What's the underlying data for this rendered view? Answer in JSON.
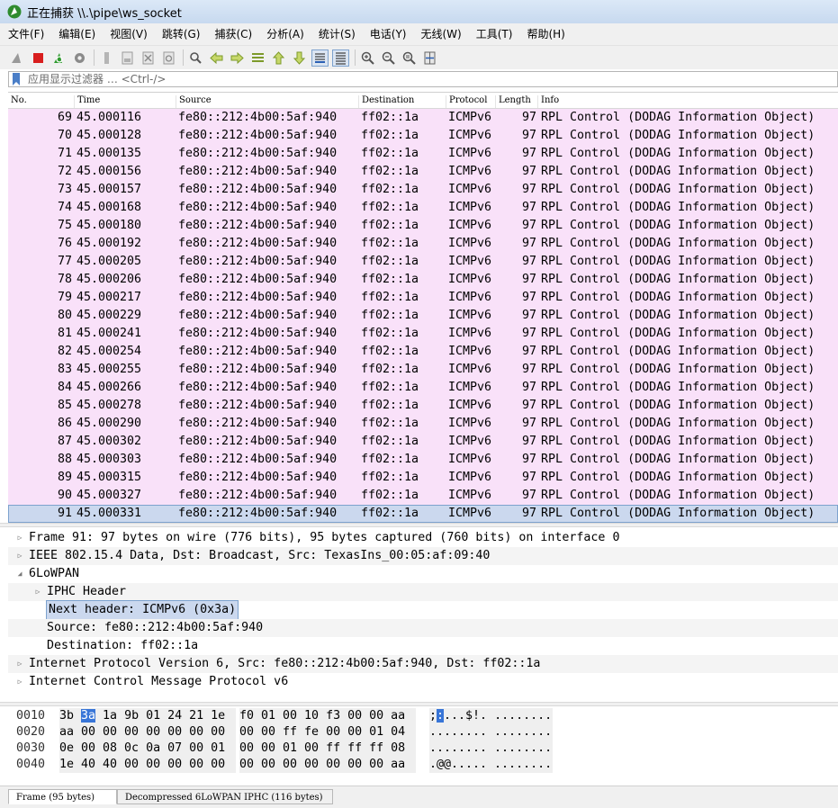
{
  "window": {
    "title": "正在捕获 \\\\.\\pipe\\ws_socket"
  },
  "menu": [
    "文件(F)",
    "编辑(E)",
    "视图(V)",
    "跳转(G)",
    "捕获(C)",
    "分析(A)",
    "统计(S)",
    "电话(Y)",
    "无线(W)",
    "工具(T)",
    "帮助(H)"
  ],
  "toolbar_icons": [
    "shark-fin-start-icon",
    "stop-capture-icon",
    "restart-capture-icon",
    "capture-options-icon",
    "open-file-icon",
    "save-file-icon",
    "close-file-icon",
    "reload-icon",
    "find-packet-icon",
    "go-back-icon",
    "go-forward-icon",
    "go-to-packet-icon",
    "go-first-icon",
    "go-last-icon",
    "auto-scroll-icon",
    "colorize-icon",
    "zoom-in-icon",
    "zoom-out-icon",
    "normal-size-icon",
    "resize-columns-icon"
  ],
  "filter": {
    "placeholder": "应用显示过滤器 … <Ctrl-/>"
  },
  "packet_list": {
    "columns": [
      "No.",
      "Time",
      "Source",
      "Destination",
      "Protocol",
      "Length",
      "Info"
    ],
    "row_color": "#f9e1f9",
    "selected_color": "#cbd8ee",
    "rows": [
      {
        "no": "69",
        "time": "45.000116",
        "src": "fe80::212:4b00:5af:940",
        "dst": "ff02::1a",
        "proto": "ICMPv6",
        "len": "97",
        "info": "RPL Control (DODAG Information Object)"
      },
      {
        "no": "70",
        "time": "45.000128",
        "src": "fe80::212:4b00:5af:940",
        "dst": "ff02::1a",
        "proto": "ICMPv6",
        "len": "97",
        "info": "RPL Control (DODAG Information Object)"
      },
      {
        "no": "71",
        "time": "45.000135",
        "src": "fe80::212:4b00:5af:940",
        "dst": "ff02::1a",
        "proto": "ICMPv6",
        "len": "97",
        "info": "RPL Control (DODAG Information Object)"
      },
      {
        "no": "72",
        "time": "45.000156",
        "src": "fe80::212:4b00:5af:940",
        "dst": "ff02::1a",
        "proto": "ICMPv6",
        "len": "97",
        "info": "RPL Control (DODAG Information Object)"
      },
      {
        "no": "73",
        "time": "45.000157",
        "src": "fe80::212:4b00:5af:940",
        "dst": "ff02::1a",
        "proto": "ICMPv6",
        "len": "97",
        "info": "RPL Control (DODAG Information Object)"
      },
      {
        "no": "74",
        "time": "45.000168",
        "src": "fe80::212:4b00:5af:940",
        "dst": "ff02::1a",
        "proto": "ICMPv6",
        "len": "97",
        "info": "RPL Control (DODAG Information Object)"
      },
      {
        "no": "75",
        "time": "45.000180",
        "src": "fe80::212:4b00:5af:940",
        "dst": "ff02::1a",
        "proto": "ICMPv6",
        "len": "97",
        "info": "RPL Control (DODAG Information Object)"
      },
      {
        "no": "76",
        "time": "45.000192",
        "src": "fe80::212:4b00:5af:940",
        "dst": "ff02::1a",
        "proto": "ICMPv6",
        "len": "97",
        "info": "RPL Control (DODAG Information Object)"
      },
      {
        "no": "77",
        "time": "45.000205",
        "src": "fe80::212:4b00:5af:940",
        "dst": "ff02::1a",
        "proto": "ICMPv6",
        "len": "97",
        "info": "RPL Control (DODAG Information Object)"
      },
      {
        "no": "78",
        "time": "45.000206",
        "src": "fe80::212:4b00:5af:940",
        "dst": "ff02::1a",
        "proto": "ICMPv6",
        "len": "97",
        "info": "RPL Control (DODAG Information Object)"
      },
      {
        "no": "79",
        "time": "45.000217",
        "src": "fe80::212:4b00:5af:940",
        "dst": "ff02::1a",
        "proto": "ICMPv6",
        "len": "97",
        "info": "RPL Control (DODAG Information Object)"
      },
      {
        "no": "80",
        "time": "45.000229",
        "src": "fe80::212:4b00:5af:940",
        "dst": "ff02::1a",
        "proto": "ICMPv6",
        "len": "97",
        "info": "RPL Control (DODAG Information Object)"
      },
      {
        "no": "81",
        "time": "45.000241",
        "src": "fe80::212:4b00:5af:940",
        "dst": "ff02::1a",
        "proto": "ICMPv6",
        "len": "97",
        "info": "RPL Control (DODAG Information Object)"
      },
      {
        "no": "82",
        "time": "45.000254",
        "src": "fe80::212:4b00:5af:940",
        "dst": "ff02::1a",
        "proto": "ICMPv6",
        "len": "97",
        "info": "RPL Control (DODAG Information Object)"
      },
      {
        "no": "83",
        "time": "45.000255",
        "src": "fe80::212:4b00:5af:940",
        "dst": "ff02::1a",
        "proto": "ICMPv6",
        "len": "97",
        "info": "RPL Control (DODAG Information Object)"
      },
      {
        "no": "84",
        "time": "45.000266",
        "src": "fe80::212:4b00:5af:940",
        "dst": "ff02::1a",
        "proto": "ICMPv6",
        "len": "97",
        "info": "RPL Control (DODAG Information Object)"
      },
      {
        "no": "85",
        "time": "45.000278",
        "src": "fe80::212:4b00:5af:940",
        "dst": "ff02::1a",
        "proto": "ICMPv6",
        "len": "97",
        "info": "RPL Control (DODAG Information Object)"
      },
      {
        "no": "86",
        "time": "45.000290",
        "src": "fe80::212:4b00:5af:940",
        "dst": "ff02::1a",
        "proto": "ICMPv6",
        "len": "97",
        "info": "RPL Control (DODAG Information Object)"
      },
      {
        "no": "87",
        "time": "45.000302",
        "src": "fe80::212:4b00:5af:940",
        "dst": "ff02::1a",
        "proto": "ICMPv6",
        "len": "97",
        "info": "RPL Control (DODAG Information Object)"
      },
      {
        "no": "88",
        "time": "45.000303",
        "src": "fe80::212:4b00:5af:940",
        "dst": "ff02::1a",
        "proto": "ICMPv6",
        "len": "97",
        "info": "RPL Control (DODAG Information Object)"
      },
      {
        "no": "89",
        "time": "45.000315",
        "src": "fe80::212:4b00:5af:940",
        "dst": "ff02::1a",
        "proto": "ICMPv6",
        "len": "97",
        "info": "RPL Control (DODAG Information Object)"
      },
      {
        "no": "90",
        "time": "45.000327",
        "src": "fe80::212:4b00:5af:940",
        "dst": "ff02::1a",
        "proto": "ICMPv6",
        "len": "97",
        "info": "RPL Control (DODAG Information Object)"
      },
      {
        "no": "91",
        "time": "45.000331",
        "src": "fe80::212:4b00:5af:940",
        "dst": "ff02::1a",
        "proto": "ICMPv6",
        "len": "97",
        "info": "RPL Control (DODAG Information Object)",
        "selected": true
      }
    ]
  },
  "details": [
    {
      "text": "Frame 91: 97 bytes on wire (776 bits), 95 bytes captured (760 bits) on interface 0",
      "expander": "collapsed",
      "level": 0
    },
    {
      "text": "IEEE 802.15.4 Data, Dst: Broadcast, Src: TexasIns_00:05:af:09:40",
      "expander": "collapsed",
      "level": 0
    },
    {
      "text": "6LoWPAN",
      "expander": "expanded",
      "level": 0
    },
    {
      "text": "IPHC Header",
      "expander": "collapsed",
      "level": 1
    },
    {
      "text": "Next header: ICMPv6 (0x3a)",
      "expander": "none",
      "level": 1,
      "selected": true
    },
    {
      "text": "Source: fe80::212:4b00:5af:940",
      "expander": "none",
      "level": 1
    },
    {
      "text": "Destination: ff02::1a",
      "expander": "none",
      "level": 1
    },
    {
      "text": "Internet Protocol Version 6, Src: fe80::212:4b00:5af:940, Dst: ff02::1a",
      "expander": "collapsed",
      "level": 0
    },
    {
      "text": "Internet Control Message Protocol v6",
      "expander": "collapsed",
      "level": 0
    }
  ],
  "bytes": [
    {
      "offset": "0010",
      "hex1_pre": "3b ",
      "hex1_hl": "3a",
      "hex1_post": " 1a 9b 01 24 21 1e",
      "hex2": "f0 01 00 10 f3 00 00 aa",
      "ascii_pre": ";",
      "ascii_hl": ":",
      "ascii_post": "...$!. ........"
    },
    {
      "offset": "0020",
      "hex1_pre": "aa 00 00 00 00 00 00 00",
      "hex1_hl": "",
      "hex1_post": "",
      "hex2": "00 00 ff fe 00 00 01 04",
      "ascii_pre": "........ ........",
      "ascii_hl": "",
      "ascii_post": ""
    },
    {
      "offset": "0030",
      "hex1_pre": "0e 00 08 0c 0a 07 00 01",
      "hex1_hl": "",
      "hex1_post": "",
      "hex2": "00 00 01 00 ff ff ff 08",
      "ascii_pre": "........ ........",
      "ascii_hl": "",
      "ascii_post": ""
    },
    {
      "offset": "0040",
      "hex1_pre": "1e 40 40 00 00 00 00 00",
      "hex1_hl": "",
      "hex1_post": "",
      "hex2": "00 00 00 00 00 00 00 aa",
      "ascii_pre": ".@@..... ........",
      "ascii_hl": "",
      "ascii_post": ""
    }
  ],
  "tabs": [
    "Frame (95 bytes)",
    "Decompressed 6LoWPAN IPHC (116 bytes)"
  ]
}
